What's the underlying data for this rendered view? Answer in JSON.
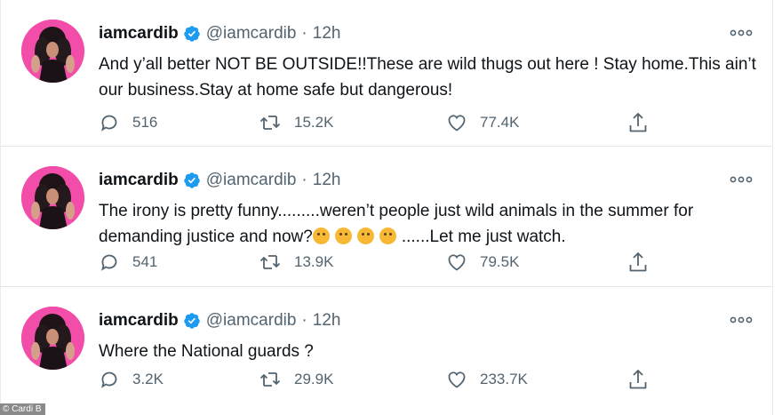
{
  "tweets": [
    {
      "name": "iamcardib",
      "handle": "@iamcardib",
      "separator": "·",
      "time": "12h",
      "text_parts": [
        "And y’all better NOT BE OUTSIDE!!These are wild thugs out here ! Stay home.This ain’t our business.Stay at home safe but dangerous!"
      ],
      "replies": "516",
      "retweets": "15.2K",
      "likes": "77.4K",
      "emoji_count": 0
    },
    {
      "name": "iamcardib",
      "handle": "@iamcardib",
      "separator": "·",
      "time": "12h",
      "text_parts": [
        "The irony is pretty funny.........weren’t people just wild animals in the summer for demanding justice and now?",
        "......Let me just watch."
      ],
      "emoji_name": "thinking-face-emoji",
      "emoji_count": 4,
      "replies": "541",
      "retweets": "13.9K",
      "likes": "79.5K"
    },
    {
      "name": "iamcardib",
      "handle": "@iamcardib",
      "separator": "·",
      "time": "12h",
      "text_parts": [
        "Where the National guards ?"
      ],
      "replies": "3.2K",
      "retweets": "29.9K",
      "likes": "233.7K",
      "emoji_count": 0
    }
  ],
  "icons": {
    "avatar": "avatar-photo",
    "verified": "verified-badge-icon",
    "more": "more-options-icon",
    "reply": "reply-icon",
    "retweet": "retweet-icon",
    "like": "like-heart-icon",
    "share": "share-icon"
  },
  "colors": {
    "verified_blue": "#1d9bf0",
    "avatar_pink": "#f24ea9",
    "muted_text": "#536471",
    "emoji_yellow": "#f7b935"
  },
  "credit": "© Cardi B"
}
